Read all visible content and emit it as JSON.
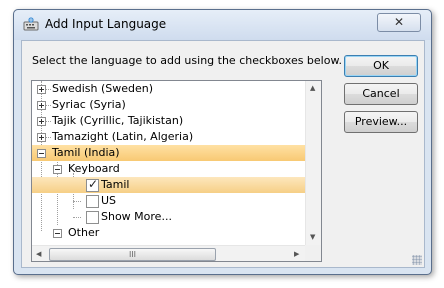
{
  "window": {
    "title": "Add Input Language",
    "close_glyph": "✕"
  },
  "instruction": "Select the language to add using the checkboxes below.",
  "tree": [
    {
      "label": "Swedish (Sweden)",
      "expander": "plus"
    },
    {
      "label": "Syriac (Syria)",
      "expander": "plus"
    },
    {
      "label": "Tajik (Cyrillic, Tajikistan)",
      "expander": "plus"
    },
    {
      "label": "Tamazight (Latin, Algeria)",
      "expander": "plus"
    },
    {
      "label": "Tamil (India)",
      "expander": "minus",
      "selected": true
    },
    {
      "label": "Keyboard",
      "expander": "minus"
    },
    {
      "label": "Tamil",
      "checked": true,
      "highlighted": true
    },
    {
      "label": "US",
      "checked": false
    },
    {
      "label": "Show More...",
      "checked": false
    },
    {
      "label": "Other",
      "expander": "minus"
    }
  ],
  "buttons": {
    "ok": "OK",
    "cancel": "Cancel",
    "preview": "Preview..."
  },
  "scroll": {
    "hthumb_glyph": "III",
    "up": "▲",
    "down": "▼",
    "left": "◀",
    "right": "▶"
  },
  "colors": {
    "selection": "#f8c973",
    "title_bar": "#d9e4f1"
  }
}
